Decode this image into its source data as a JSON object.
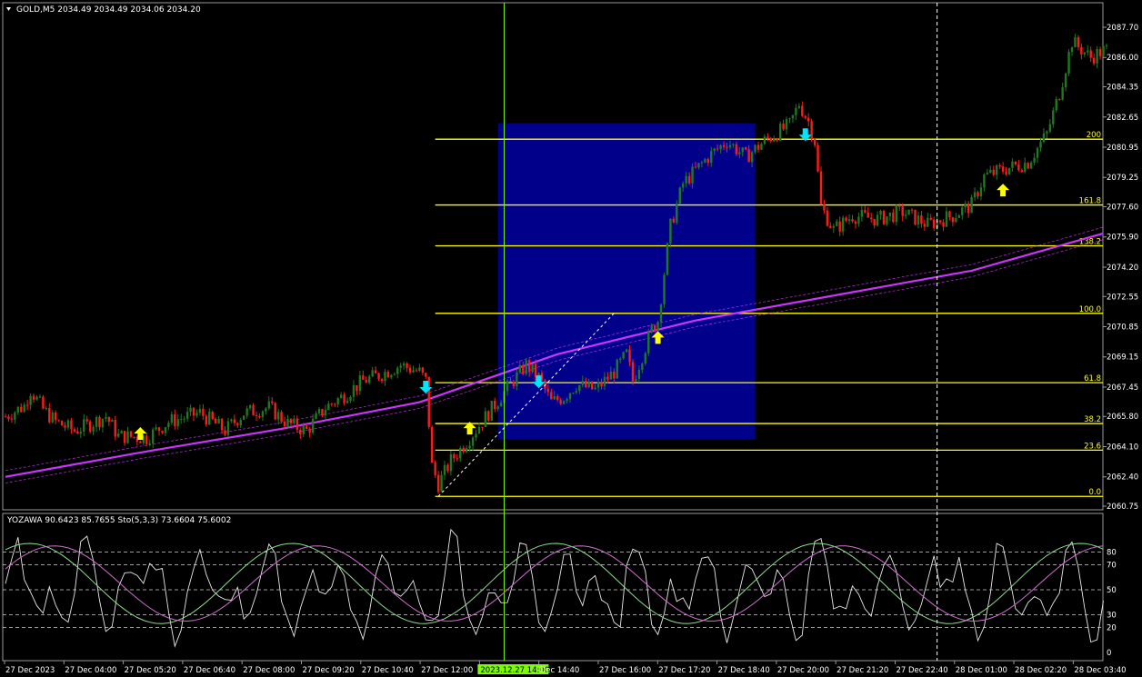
{
  "header": {
    "symbol": "GOLD,M5",
    "ohlc": "2034.49 2034.49 2034.06 2034.20"
  },
  "indicator_header": {
    "text": "YOZAWA 90.6423 85.7655  Sto(5,3,3) 73.6604 75.6002"
  },
  "colors": {
    "background": "#000000",
    "bull": "#1f7a1f",
    "bear": "#ff1a1a",
    "ma": "#cc33ff",
    "fib": "#ffff00",
    "box": "#00008b",
    "crosshair": "#7cfc00",
    "up_arrow": "#ffff00",
    "down_arrow": "#00e5ff"
  },
  "chart_data": {
    "type": "candlestick",
    "symbol": "GOLD",
    "timeframe": "M5",
    "price_ticks": [
      "2087.70",
      "2086.00",
      "2084.35",
      "2082.65",
      "2080.95",
      "2079.25",
      "2077.60",
      "2075.90",
      "2074.20",
      "2072.55",
      "2070.85",
      "2069.15",
      "2067.45",
      "2065.80",
      "2064.10",
      "2062.40",
      "2060.75"
    ],
    "price_range": [
      2060.75,
      2087.7
    ],
    "time_ticks": [
      "27 Dec 2023",
      "27 Dec 04:00",
      "27 Dec 05:20",
      "27 Dec 06:40",
      "27 Dec 08:00",
      "27 Dec 09:20",
      "27 Dec 10:40",
      "27 Dec 12:00",
      "2023.12.27 14:00",
      "Dec 14:40",
      "27 Dec 16:00",
      "27 Dec 17:20",
      "27 Dec 18:40",
      "27 Dec 20:00",
      "27 Dec 21:20",
      "27 Dec 22:40",
      "28 Dec 01:00",
      "28 Dec 02:20",
      "28 Dec 03:40"
    ],
    "fib_levels": [
      {
        "label": "200",
        "price": 2081.4
      },
      {
        "label": "161.8",
        "price": 2077.7
      },
      {
        "label": "138.2",
        "price": 2075.4
      },
      {
        "label": "100.0",
        "price": 2071.6
      },
      {
        "label": "61.8",
        "price": 2067.7
      },
      {
        "label": "38.2",
        "price": 2065.4
      },
      {
        "label": "23.6",
        "price": 2063.9
      },
      {
        "label": "0.0",
        "price": 2061.3
      }
    ],
    "box": {
      "price_top": 2082.3,
      "price_bottom": 2064.5
    },
    "waypoints": [
      [
        0,
        2065.8
      ],
      [
        6,
        2066.4
      ],
      [
        8,
        2067.3
      ],
      [
        12,
        2066.2
      ],
      [
        16,
        2065.5
      ],
      [
        22,
        2065.0
      ],
      [
        26,
        2065.3
      ],
      [
        32,
        2065.8
      ],
      [
        36,
        2064.7
      ],
      [
        45,
        2064.6
      ],
      [
        52,
        2065.5
      ],
      [
        62,
        2066.0
      ],
      [
        70,
        2065.0
      ],
      [
        76,
        2066.0
      ],
      [
        84,
        2066.3
      ],
      [
        90,
        2065.4
      ],
      [
        96,
        2065.0
      ],
      [
        102,
        2066.3
      ],
      [
        108,
        2067.0
      ],
      [
        114,
        2067.8
      ],
      [
        120,
        2068.2
      ],
      [
        126,
        2068.7
      ],
      [
        132,
        2068.3
      ],
      [
        134,
        2067.8
      ],
      [
        136,
        2063.0
      ],
      [
        138,
        2062.0
      ],
      [
        142,
        2063.3
      ],
      [
        148,
        2064.6
      ],
      [
        154,
        2066.0
      ],
      [
        160,
        2067.4
      ],
      [
        166,
        2068.7
      ],
      [
        170,
        2068.0
      ],
      [
        174,
        2066.6
      ],
      [
        178,
        2066.9
      ],
      [
        182,
        2067.6
      ],
      [
        188,
        2067.3
      ],
      [
        194,
        2068.3
      ],
      [
        198,
        2069.3
      ],
      [
        200,
        2067.8
      ],
      [
        204,
        2069.7
      ],
      [
        206,
        2070.7
      ],
      [
        208,
        2071.2
      ],
      [
        210,
        2073.9
      ],
      [
        212,
        2076.5
      ],
      [
        216,
        2078.9
      ],
      [
        224,
        2080.4
      ],
      [
        230,
        2081.3
      ],
      [
        236,
        2080.4
      ],
      [
        242,
        2081.3
      ],
      [
        250,
        2082.2
      ],
      [
        253,
        2083.4
      ],
      [
        256,
        2082.4
      ],
      [
        258,
        2081.3
      ],
      [
        260,
        2077.6
      ],
      [
        264,
        2076.3
      ],
      [
        270,
        2077.1
      ],
      [
        278,
        2076.9
      ],
      [
        286,
        2077.3
      ],
      [
        294,
        2076.6
      ],
      [
        302,
        2077.1
      ],
      [
        308,
        2077.7
      ],
      [
        312,
        2079.3
      ],
      [
        318,
        2079.7
      ],
      [
        326,
        2080.1
      ],
      [
        332,
        2081.7
      ],
      [
        336,
        2084.0
      ],
      [
        340,
        2086.9
      ],
      [
        346,
        2086.0
      ],
      [
        350,
        2086.4
      ]
    ],
    "ma": [
      2062.4,
      2063.8,
      2065.1,
      2066.6,
      2069.3,
      2071.2,
      2072.6,
      2074.0,
      2076.2
    ],
    "oscillator": {
      "name": "YOZAWA / Sto(5,3,3)",
      "values": [
        90.6423,
        85.7655,
        73.6604,
        75.6002
      ],
      "ticks": [
        "80",
        "70",
        "50",
        "30",
        "20",
        "0"
      ],
      "range": [
        0,
        100
      ]
    },
    "signals": {
      "up": [
        [
          43,
          2065.3
        ],
        [
          148,
          2065.6
        ],
        [
          208,
          2070.7
        ],
        [
          318,
          2079.0
        ]
      ],
      "down": [
        [
          134,
          2067.4
        ],
        [
          170,
          2067.7
        ],
        [
          255,
          2081.6
        ]
      ]
    }
  }
}
